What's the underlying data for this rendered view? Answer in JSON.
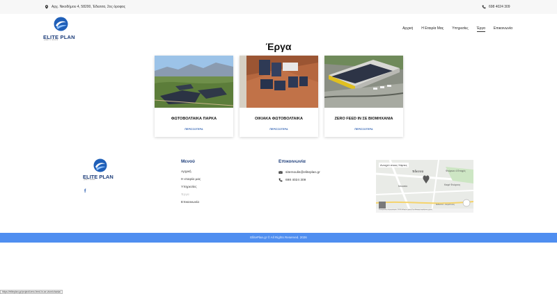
{
  "topbar": {
    "address": "Αρχ. Νικοδήμου 4, 58200, Έδεσσα, 2ος όροφος",
    "phone": "698 4024 309"
  },
  "logo": {
    "brand": "ELITE PLAN",
    "tagline": "QUALITY WORKS"
  },
  "nav": {
    "items": [
      "Αρχική",
      "Η Εταιρία Μας",
      "Υπηρεσίες",
      "Έργα",
      "Επικοινωνία"
    ],
    "active": "Έργα"
  },
  "page": {
    "title": "Έργα"
  },
  "cards": [
    {
      "title": "ΦΩΤΟΒΟΛΤΑΙΚΑ ΠΑΡΚΑ",
      "more": "ΠΕΡΙΣΣΟΤΕΡΑ"
    },
    {
      "title": "ΟΙΚΙΑΚΑ ΦΩΤΟΒΟΛΤΑΙΚΑ",
      "more": "ΠΕΡΙΣΣΟΤΕΡΑ"
    },
    {
      "title": "ZERO FEED IN ΣΕ ΒΙΟΜΗΧΑΝΙΑ",
      "more": "ΠΕΡΙΣΣΟΤΕΡΑ"
    }
  ],
  "footer": {
    "menu_title": "Μενού",
    "menu_items": [
      "Αρχική",
      "Η εταιρία μας",
      "Υπηρεσίες",
      "Έργα",
      "Επικοινωνία"
    ],
    "contact_title": "Επικοινωνία",
    "email": "sitemoulis@eliteplan.gr",
    "phone": "698 4024 309",
    "map": {
      "search_label": "Ανοιχτό στους Χάρτες",
      "city_label": "Έδεσσα",
      "poi_1": "Φούρνοι 4 Εποχές",
      "poi_2": "Καφέ Φούρνος",
      "poi_3": "Μουσείο",
      "poi_4": "Έδεσσα - Ακρόπολη",
      "footer_text": "Συντομεύσεις πληκτρολογίου  ©2024 Δεδομένα χάρτη  Όροι  Αναφορά σφάλματος χάρτη"
    },
    "copyright": "EllitePlan.gr © All Rights Reserved. 2026"
  },
  "status_url": "https://eliteplan.gr/project/zero-feed-in-se-viomichania/",
  "colors": {
    "accent": "#4f8ef0",
    "brand": "#1d3d7a",
    "link": "#2a5db0"
  }
}
